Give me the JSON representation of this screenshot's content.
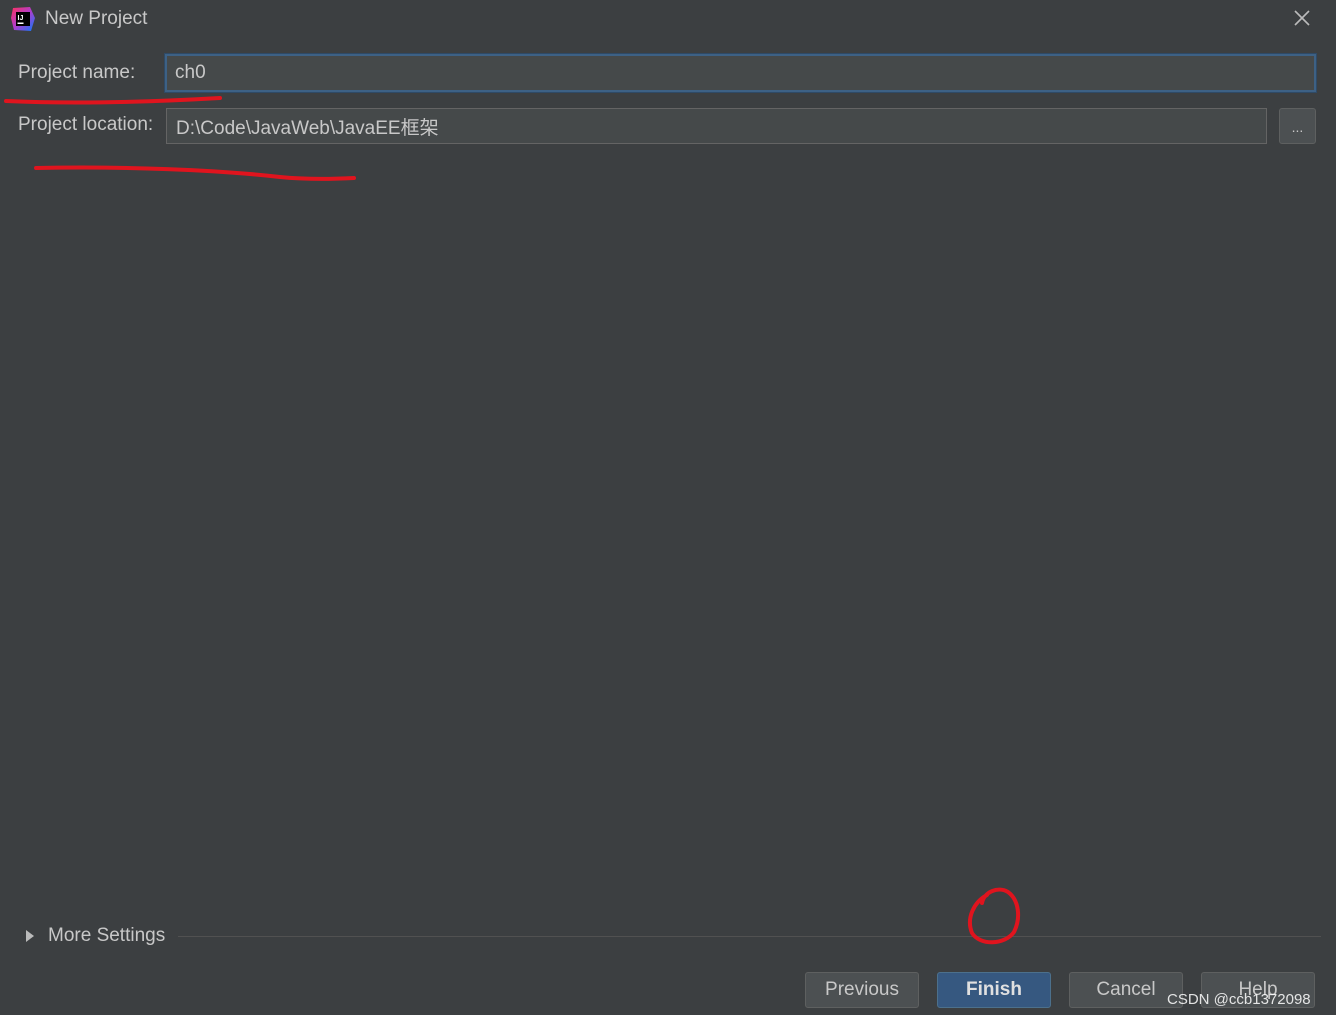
{
  "window": {
    "title": "New Project",
    "logo_icon": "intellij-idea-logo-icon",
    "close_icon": "close-icon"
  },
  "form": {
    "project_name_label": "Project name:",
    "project_name_value": "ch0",
    "project_location_label": "Project location:",
    "project_location_value": "D:\\Code\\JavaWeb\\JavaEE框架",
    "browse_label": "..."
  },
  "more_settings": {
    "label": "More Settings",
    "expanded": false
  },
  "buttons": {
    "previous": "Previous",
    "finish": "Finish",
    "cancel": "Cancel",
    "help": "Help"
  },
  "watermark": "CSDN @ccb1372098",
  "colors": {
    "background": "#3c3f41",
    "input_background": "#45494a",
    "focus_border": "#3d6185",
    "primary_button": "#365880",
    "annotation_red": "#e0141e"
  }
}
